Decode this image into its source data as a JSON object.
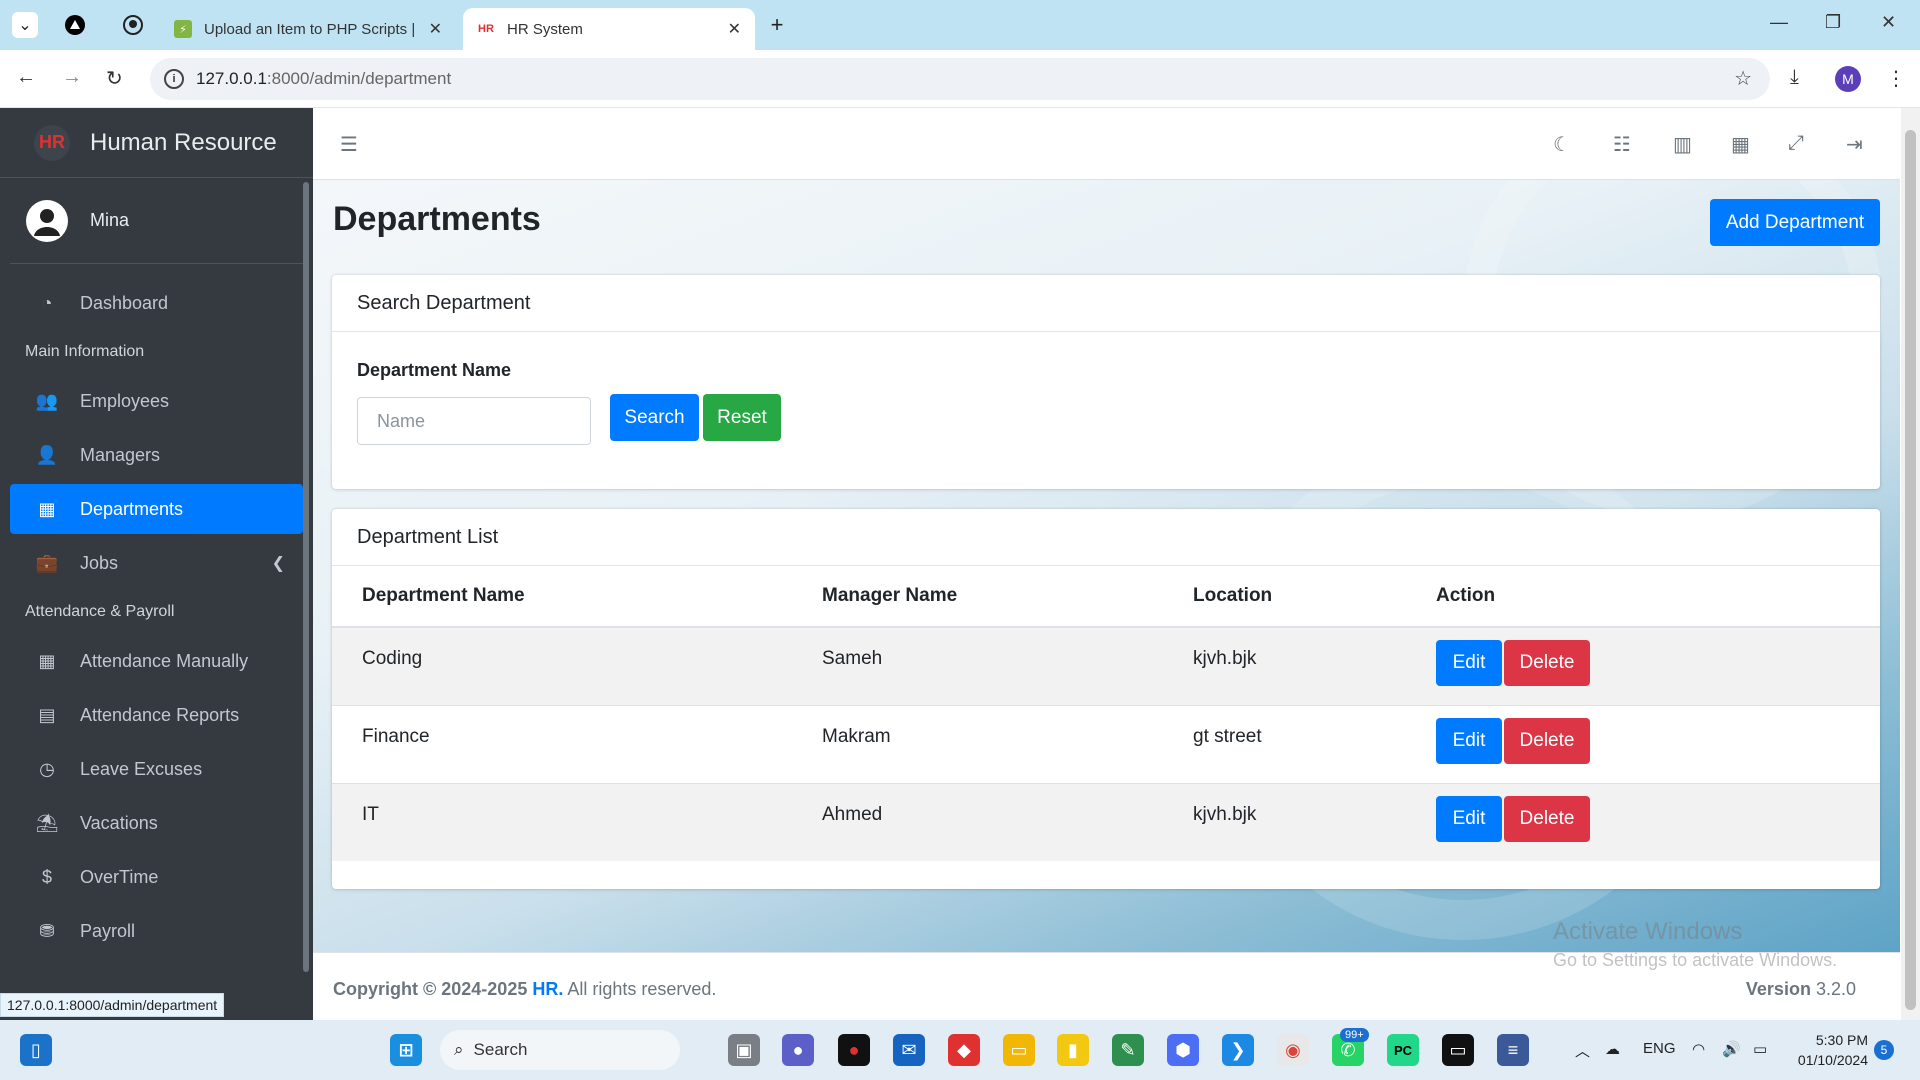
{
  "browser": {
    "tabs": [
      {
        "title": "Upload an Item to PHP Scripts |",
        "active": false
      },
      {
        "title": "HR System",
        "active": true
      }
    ],
    "url_host": "127.0.0.1",
    "url_path": ":8000/admin/department",
    "profile_initial": "M",
    "status_url": "127.0.0.1:8000/admin/department"
  },
  "sidebar": {
    "brand": "Human Resource",
    "brand_logo": "HR",
    "user": "Mina",
    "items": [
      {
        "label": "Dashboard",
        "icon": "tachometer-icon"
      },
      {
        "header": "Main Information"
      },
      {
        "label": "Employees",
        "icon": "users-icon"
      },
      {
        "label": "Managers",
        "icon": "user-icon"
      },
      {
        "label": "Departments",
        "icon": "building-icon",
        "active": true
      },
      {
        "label": "Jobs",
        "icon": "briefcase-icon",
        "caret": true
      },
      {
        "header": "Attendance & Payroll"
      },
      {
        "label": "Attendance Manually",
        "icon": "calendar-icon"
      },
      {
        "label": "Attendance Reports",
        "icon": "file-icon"
      },
      {
        "label": "Leave Excuses",
        "icon": "clock-icon"
      },
      {
        "label": "Vacations",
        "icon": "umbrella-beach-icon"
      },
      {
        "label": "OverTime",
        "icon": "dollar-icon"
      },
      {
        "label": "Payroll",
        "icon": "coins-icon"
      }
    ]
  },
  "page": {
    "title": "Departments",
    "add_button": "Add Department",
    "search_card_title": "Search Department",
    "field_label": "Department Name",
    "name_placeholder": "Name",
    "search_button": "Search",
    "reset_button": "Reset",
    "list_card_title": "Department List",
    "columns": [
      "Department Name",
      "Manager Name",
      "Location",
      "Action"
    ],
    "rows": [
      {
        "department": "Coding",
        "manager": "Sameh",
        "location": "kjvh.bjk"
      },
      {
        "department": "Finance",
        "manager": "Makram",
        "location": "gt street"
      },
      {
        "department": "IT",
        "manager": "Ahmed",
        "location": "kjvh.bjk"
      }
    ],
    "edit_label": "Edit",
    "delete_label": "Delete"
  },
  "footer": {
    "copyright": "Copyright © 2024-2025",
    "brand": "HR.",
    "rights": "All rights reserved.",
    "version_label": "Version",
    "version": "3.2.0"
  },
  "watermark": {
    "title": "Activate Windows",
    "subtitle": "Go to Settings to activate Windows."
  },
  "taskbar": {
    "search": "Search",
    "language": "ENG",
    "time": "5:30 PM",
    "date": "01/10/2024",
    "notification_count": "5",
    "whatsapp_badge": "99+"
  },
  "colors": {
    "primary": "#007bff",
    "success": "#28a745",
    "danger": "#dc3545",
    "sidebar": "#343a40"
  }
}
